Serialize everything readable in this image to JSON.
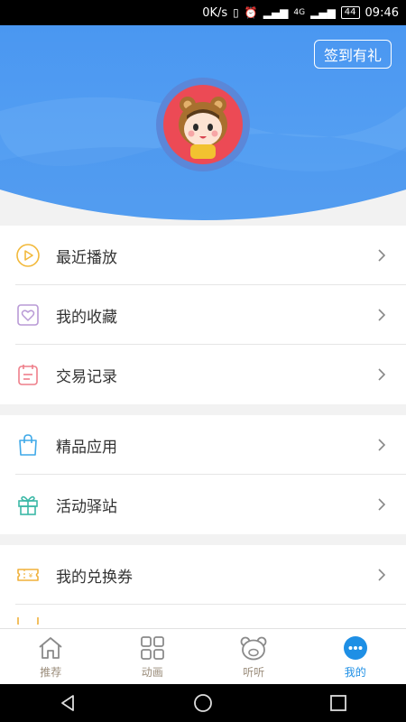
{
  "status_bar": {
    "speed": "0K/s",
    "network": "4G",
    "battery": "44",
    "time": "09:46"
  },
  "header": {
    "signin_label": "签到有礼",
    "colors": {
      "primary": "#4e9bf2",
      "avatar_bg": "#ec4a55"
    }
  },
  "menu": {
    "group1": [
      {
        "label": "最近播放",
        "icon": "play-circle-icon"
      },
      {
        "label": "我的收藏",
        "icon": "heart-icon"
      },
      {
        "label": "交易记录",
        "icon": "record-icon"
      }
    ],
    "group2": [
      {
        "label": "精品应用",
        "icon": "shopping-bag-icon"
      },
      {
        "label": "活动驿站",
        "icon": "gift-icon"
      }
    ],
    "group3": [
      {
        "label": "我的兑换券",
        "icon": "coupon-icon"
      }
    ]
  },
  "tabs": [
    {
      "label": "推荐",
      "icon": "home-icon"
    },
    {
      "label": "动画",
      "icon": "grid-icon"
    },
    {
      "label": "听听",
      "icon": "bear-icon"
    },
    {
      "label": "我的",
      "icon": "more-icon"
    }
  ],
  "active_tab": "我的"
}
